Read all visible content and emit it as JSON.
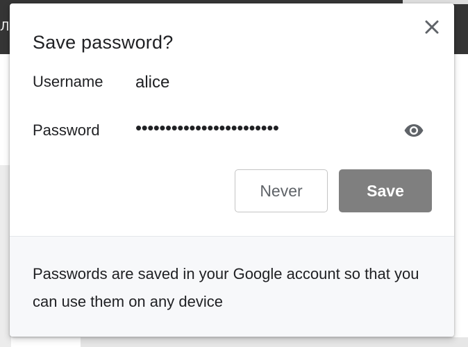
{
  "background": {
    "toolbar_text": "Л"
  },
  "dialog": {
    "title": "Save password?",
    "close_icon": "close-icon",
    "username_label": "Username",
    "username_value": "alice",
    "password_label": "Password",
    "password_value": "••••••••••••••••••••••••",
    "reveal_icon": "eye-icon",
    "never_label": "Never",
    "save_label": "Save",
    "footer_text": "Passwords are saved in your Google account so that you can use them on any device"
  },
  "colors": {
    "save_button": "#7f7f7f",
    "toolbar": "#353535",
    "footer_bg": "#f7f8fa"
  }
}
